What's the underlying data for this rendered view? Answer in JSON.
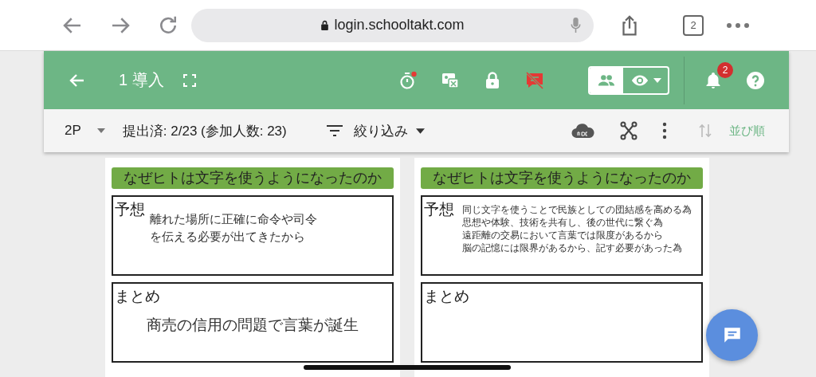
{
  "browser": {
    "url": "login.schooltakt.com",
    "tab_count": "2"
  },
  "header": {
    "title": "1 導入",
    "timer_alert": true,
    "notification_count": "2",
    "view_toggle": [
      {
        "kind": "people",
        "selected": true
      },
      {
        "kind": "eye",
        "selected": false
      }
    ]
  },
  "toolbar": {
    "class_select": "2P",
    "submitted": "提出済: 2/23 (参加人数: 23)",
    "filter": "絞り込み",
    "sort": "並び順"
  },
  "cards": [
    {
      "title": "なぜヒトは文字を使うようになったのか",
      "sections": [
        {
          "label": "予想",
          "kind": "prediction",
          "lines": [
            "離れた場所に正確に命令や司令を伝える必要が出てきたから"
          ]
        },
        {
          "label": "まとめ",
          "kind": "summary",
          "lines": [
            "商売の信用の問題で言葉が誕生"
          ]
        }
      ]
    },
    {
      "title": "なぜヒトは文字を使うようになったのか",
      "sections": [
        {
          "label": "予想",
          "kind": "prediction",
          "lines": [
            "同じ文字を使うことで民族としての団結感を高める為",
            "思想や体験、技術を共有し、後の世代に繋ぐ為",
            "遠距離の交易において言葉では限度があるから",
            "脳の記憶には限界があるから、記す必要があった為"
          ]
        },
        {
          "label": "まとめ",
          "kind": "summary"
        }
      ]
    }
  ]
}
